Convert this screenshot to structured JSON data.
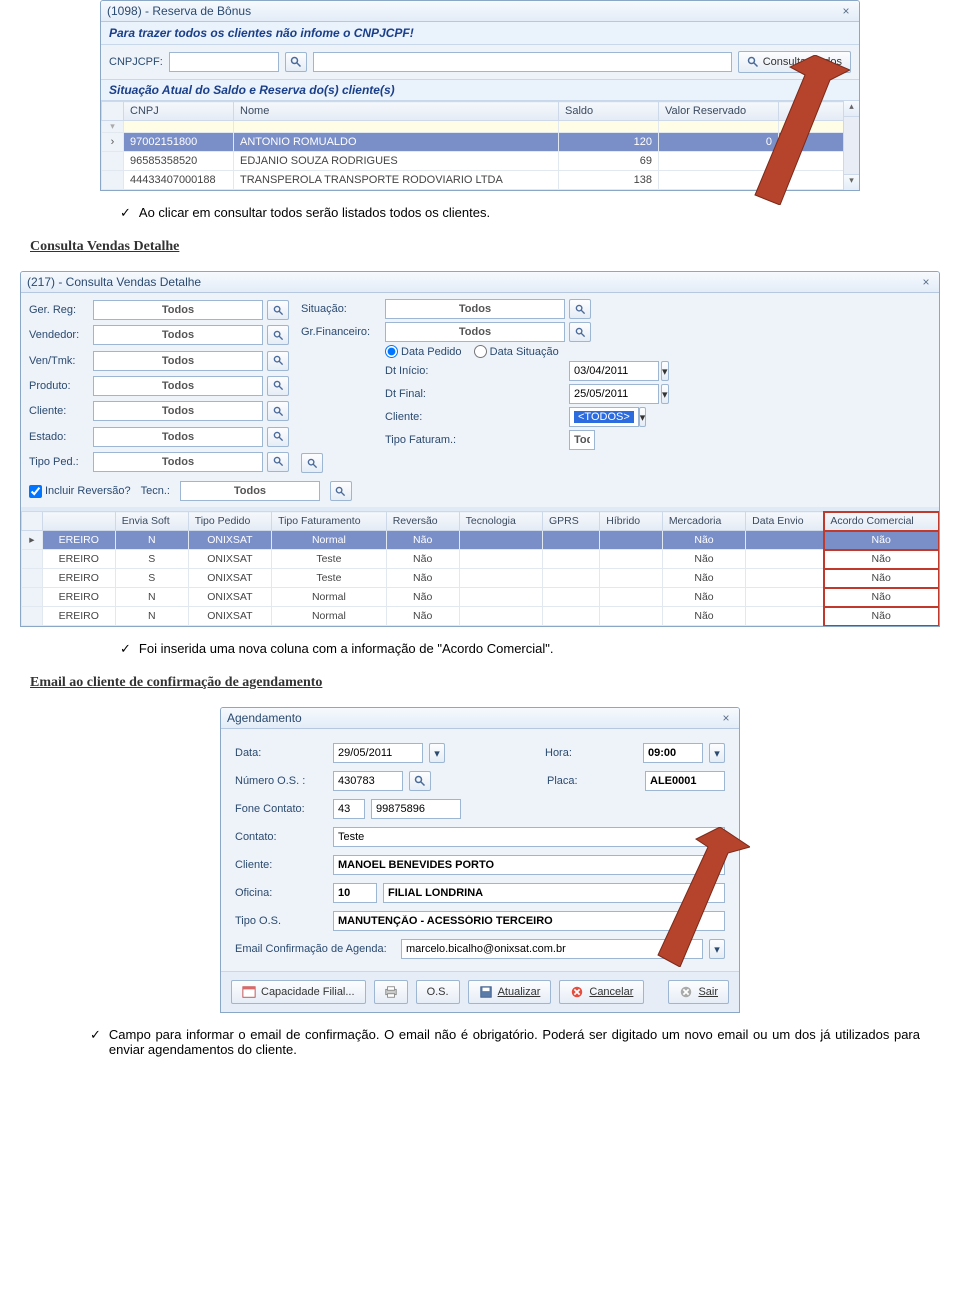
{
  "fig1": {
    "title": "(1098) - Reserva de Bônus",
    "banner": "Para trazer todos os clientes não infome o CNPJCPF!",
    "cpf_label": "CNPJCPF:",
    "consultar_btn": "Consultar Todos",
    "section": "Situação Atual do Saldo e Reserva do(s) cliente(s)",
    "cols": [
      "CNPJ",
      "Nome",
      "Saldo",
      "Valor Reservado",
      ""
    ],
    "rows": [
      {
        "cnpj": "97002151800",
        "nome": "ANTONIO ROMUALDO",
        "saldo": "120",
        "res": "0",
        "last": "0",
        "sel": true
      },
      {
        "cnpj": "96585358520",
        "nome": "EDJANIO SOUZA RODRIGUES",
        "saldo": "69",
        "res": "",
        "last": "0",
        "sel": false
      },
      {
        "cnpj": "44433407000188",
        "nome": "TRANSPEROLA TRANSPORTE RODOVIARIO LTDA",
        "saldo": "138",
        "res": "0",
        "last": "0",
        "sel": false
      }
    ]
  },
  "bullet1": "Ao clicar em consultar todos serão listados todos os clientes.",
  "heading2": "Consulta Vendas Detalhe",
  "fig2": {
    "title": "(217) - Consulta Vendas Detalhe",
    "labels": {
      "gerreg": "Ger. Reg:",
      "vendedor": "Vendedor:",
      "ventmk": "Ven/Tmk:",
      "produto": "Produto:",
      "cliente": "Cliente:",
      "estado": "Estado:",
      "tipoped": "Tipo Ped.:",
      "situacao": "Situação:",
      "grfin": "Gr.Financeiro:",
      "datapedido": "Data Pedido",
      "datasit": "Data Situação",
      "dtini": "Dt Início:",
      "dtfin": "Dt Final:",
      "cliente2": "Cliente:",
      "tipofat": "Tipo Faturam.:",
      "increv": "Incluir Reversão?",
      "tecn": "Tecn.:"
    },
    "vals": {
      "todos": "Todos",
      "dtini": "03/04/2011",
      "dtfin": "25/05/2011",
      "seltodos": "<TODOS>"
    },
    "cols": [
      "",
      "Envia Soft",
      "Tipo Pedido",
      "Tipo Faturamento",
      "Reversão",
      "Tecnologia",
      "GPRS",
      "Híbrido",
      "Mercadoria",
      "Data Envio",
      "Acordo Comercial"
    ],
    "rows": [
      {
        "c0": "EREIRO",
        "c1": "N",
        "c2": "ONIXSAT",
        "c3": "Normal",
        "c4": "Não",
        "c5": "",
        "c6": "",
        "c7": "",
        "c8": "Não",
        "c9": "",
        "c10": "Não",
        "sel": true
      },
      {
        "c0": "EREIRO",
        "c1": "S",
        "c2": "ONIXSAT",
        "c3": "Teste",
        "c4": "Não",
        "c5": "",
        "c6": "",
        "c7": "",
        "c8": "Não",
        "c9": "",
        "c10": "Não"
      },
      {
        "c0": "EREIRO",
        "c1": "S",
        "c2": "ONIXSAT",
        "c3": "Teste",
        "c4": "Não",
        "c5": "",
        "c6": "",
        "c7": "",
        "c8": "Não",
        "c9": "",
        "c10": "Não"
      },
      {
        "c0": "EREIRO",
        "c1": "N",
        "c2": "ONIXSAT",
        "c3": "Normal",
        "c4": "Não",
        "c5": "",
        "c6": "",
        "c7": "",
        "c8": "Não",
        "c9": "",
        "c10": "Não"
      },
      {
        "c0": "EREIRO",
        "c1": "N",
        "c2": "ONIXSAT",
        "c3": "Normal",
        "c4": "Não",
        "c5": "",
        "c6": "",
        "c7": "",
        "c8": "Não",
        "c9": "",
        "c10": "Não"
      }
    ]
  },
  "bullet2": "Foi inserida uma nova coluna com a informação de \"Acordo Comercial\".",
  "heading3": "Email ao cliente de confirmação de agendamento",
  "fig3": {
    "title": "Agendamento",
    "labels": {
      "data": "Data:",
      "hora": "Hora:",
      "numos": "Número O.S. :",
      "placa": "Placa:",
      "fone": "Fone Contato:",
      "contato": "Contato:",
      "cliente": "Cliente:",
      "oficina": "Oficina:",
      "tipoos": "Tipo O.S.",
      "email": "Email Confirmação de Agenda:"
    },
    "vals": {
      "data": "29/05/2011",
      "hora": "09:00",
      "numos": "430783",
      "placa": "ALE0001",
      "ddd": "43",
      "fone": "99875896",
      "contato": "Teste",
      "cliente": "MANOEL BENEVIDES PORTO",
      "oficcod": "10",
      "oficnome": "FILIAL LONDRINA",
      "tipoos": "MANUTENÇÃO - ACESSÓRIO TERCEIRO",
      "email": "marcelo.bicalho@onixsat.com.br"
    },
    "btns": {
      "cap": "Capacidade Filial...",
      "os": "O.S.",
      "atual": "Atualizar",
      "canc": "Cancelar",
      "sair": "Sair"
    }
  },
  "bullet3": "Campo para informar o email de confirmação. O email não é obrigatório. Poderá ser digitado um novo email ou um dos já utilizados para enviar agendamentos do cliente."
}
